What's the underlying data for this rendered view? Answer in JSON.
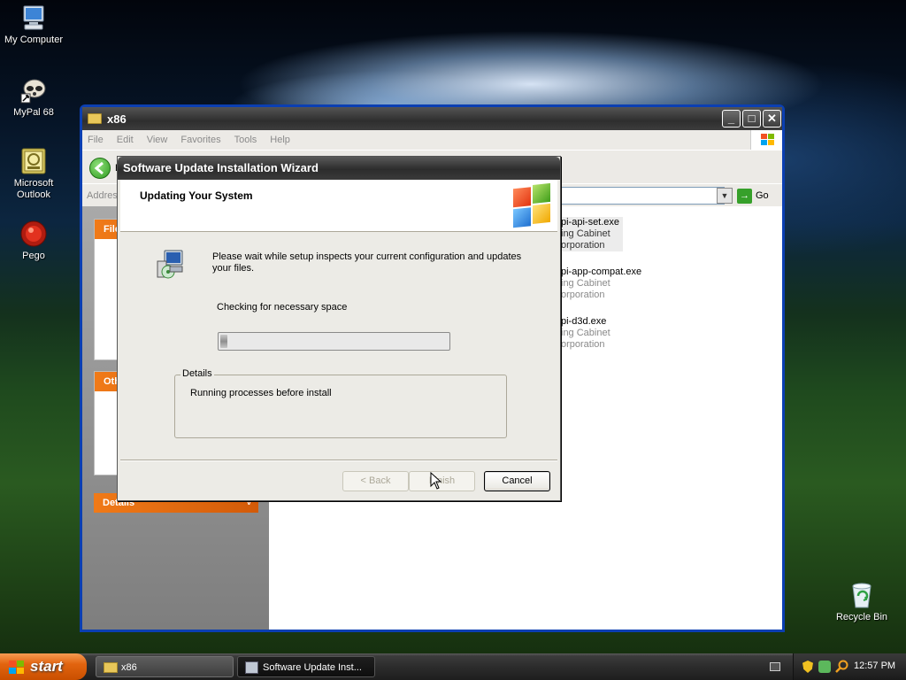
{
  "desktop": {
    "icons": [
      {
        "label": "My Computer",
        "icon": "computer-icon"
      },
      {
        "label": "MyPal 68",
        "icon": "mypal-icon"
      },
      {
        "label": "Microsoft Outlook",
        "icon": "outlook-icon"
      },
      {
        "label": "Pego",
        "icon": "pego-icon"
      },
      {
        "label": "Recycle Bin",
        "icon": "recycle-bin-icon"
      }
    ]
  },
  "explorer": {
    "title": "x86",
    "menu": [
      "File",
      "Edit",
      "View",
      "Favorites",
      "Tools",
      "Help"
    ],
    "toolbar": {
      "back_label": "B"
    },
    "address": {
      "label": "Addres",
      "go_label": "Go"
    },
    "left_pane": {
      "sections": [
        "File",
        "Oth",
        "Details"
      ]
    },
    "files": [
      {
        "name": "pi-api-set.exe",
        "type": "ing Cabinet",
        "company": "orporation"
      },
      {
        "name": "pi-app-compat.exe",
        "type": "ing Cabinet",
        "company": "orporation"
      },
      {
        "name": "pi-d3d.exe",
        "type": "ing Cabinet",
        "company": "orporation"
      }
    ]
  },
  "wizard": {
    "title": "Software Update Installation Wizard",
    "header": "Updating Your System",
    "message": "Please wait while setup inspects your current configuration and updates your files.",
    "status": "Checking for necessary space",
    "progress_fraction": 0.03,
    "details_label": "Details",
    "details_text": "Running processes before install",
    "buttons": {
      "back": "< Back",
      "finish": "Finish",
      "cancel": "Cancel"
    }
  },
  "taskbar": {
    "start_label": "start",
    "tasks": [
      {
        "label": "x86",
        "icon": "folder-icon"
      },
      {
        "label": "Software Update Inst...",
        "icon": "setup-icon"
      }
    ],
    "clock": "12:57 PM"
  },
  "colors": {
    "wizard_title": "#3a3a3a",
    "taskbox_header": "#e66a0e",
    "start_button": "#e2640f"
  }
}
